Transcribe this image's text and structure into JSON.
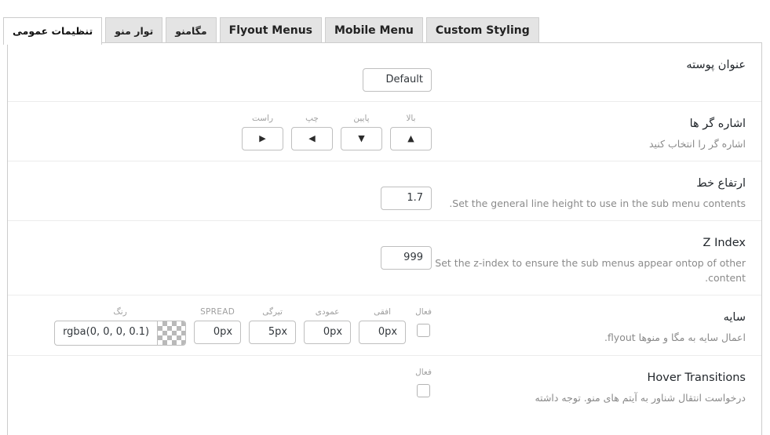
{
  "tabs": [
    {
      "label": "تنظیمات عمومی",
      "active": true,
      "lang": "fa"
    },
    {
      "label": "توار منو",
      "active": false,
      "lang": "fa"
    },
    {
      "label": "مگامنو",
      "active": false,
      "lang": "fa"
    },
    {
      "label": "Flyout Menus",
      "active": false,
      "lang": "en"
    },
    {
      "label": "Mobile Menu",
      "active": false,
      "lang": "en"
    },
    {
      "label": "Custom Styling",
      "active": false,
      "lang": "en"
    }
  ],
  "rows": [
    {
      "title": "عنوان پوسته",
      "desc": "",
      "fields": [
        {
          "kind": "select",
          "label": "",
          "value": "Default"
        }
      ]
    },
    {
      "title": "اشاره گر ها",
      "desc": "اشاره گر را انتخاب کنید",
      "fields": [
        {
          "kind": "arrow",
          "label": "راست",
          "value": "▶"
        },
        {
          "kind": "arrow",
          "label": "چپ",
          "value": "◀"
        },
        {
          "kind": "arrow",
          "label": "پایین",
          "value": "▼"
        },
        {
          "kind": "arrow",
          "label": "بالا",
          "value": "▲"
        }
      ]
    },
    {
      "title": "ارتفاع خط",
      "desc": "Set the general line height to use in the sub menu contents.",
      "fields": [
        {
          "kind": "number",
          "label": "",
          "value": "1.7"
        }
      ]
    },
    {
      "title": "Z Index",
      "desc": "Set the z-index to ensure the sub menus appear ontop of other content.",
      "fields": [
        {
          "kind": "number",
          "label": "",
          "value": "999"
        }
      ]
    },
    {
      "title": "سایه",
      "desc": "اعمال سایه به مگا و منوها flyout.",
      "fields": [
        {
          "kind": "color",
          "label": "رنگ",
          "value": "rgba(0, 0, 0, 0.1)"
        },
        {
          "kind": "text",
          "label": "SPREAD",
          "value": "0px"
        },
        {
          "kind": "text",
          "label": "تیرگی",
          "value": "5px"
        },
        {
          "kind": "text",
          "label": "عمودی",
          "value": "0px"
        },
        {
          "kind": "text",
          "label": "افقی",
          "value": "0px"
        },
        {
          "kind": "checkbox",
          "label": "فعال",
          "value": ""
        }
      ]
    },
    {
      "title": "Hover Transitions",
      "desc": "درخواست انتقال شناور به آیتم های منو. توجه داشته",
      "fields": [
        {
          "kind": "checkbox",
          "label": "فعال",
          "value": ""
        }
      ]
    }
  ],
  "colors": {
    "tab_active_bg": "#ffffff",
    "tab_inactive_bg": "#e4e4e4",
    "border": "#cccccc",
    "divider": "#ececec",
    "title_text": "#23282d",
    "desc_text": "#8a8a8a",
    "field_label": "#a0a0a0"
  }
}
